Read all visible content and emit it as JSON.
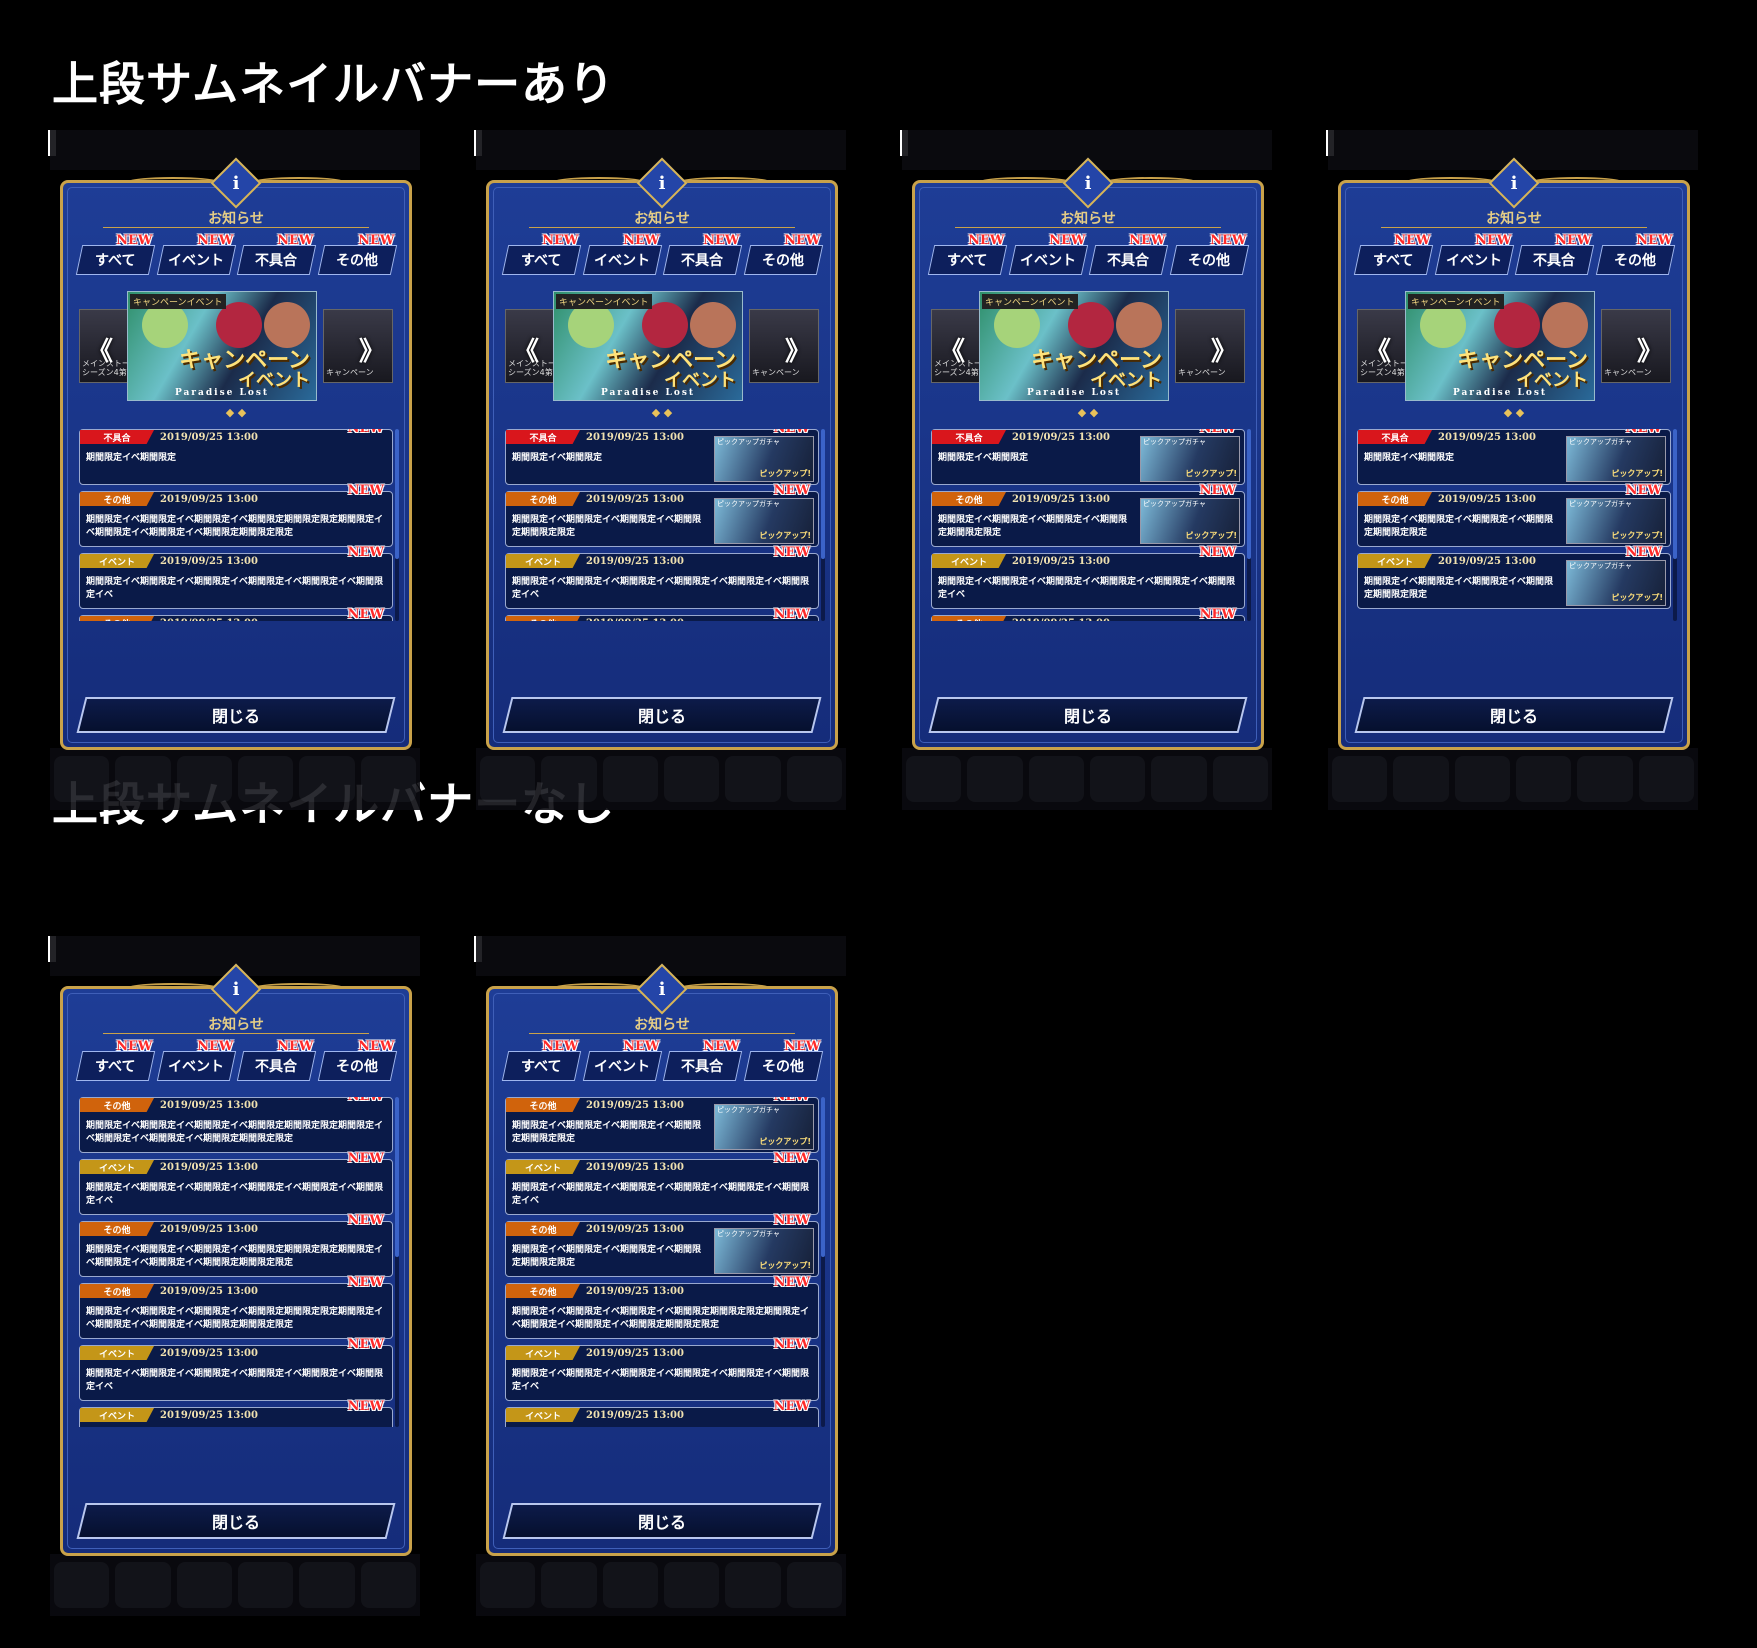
{
  "sections": [
    {
      "title": "上段サムネイルバナーあり"
    },
    {
      "title": "上段サムネイルバナーなし"
    }
  ],
  "panel": {
    "info_icon": "i",
    "title": "お知らせ",
    "tabs": [
      "すべて",
      "イベント",
      "不具合",
      "その他"
    ],
    "new_label": "NEW",
    "close_label": "閉じる"
  },
  "banner": {
    "tag": "キャンペーンイベント",
    "title_line1": "キャンペーン",
    "title_line2": "イベント",
    "footer": "Paradise Lost",
    "left_text": "メインストーリーシーズン4第1章",
    "right_text": "キャンペーン",
    "dots": "◆ ◆",
    "prev": "《",
    "next": "》"
  },
  "thumb": {
    "label": "ピックアップガチャ",
    "caption": "ピックアップ!"
  },
  "categories": {
    "bug": "不具合",
    "other": "その他",
    "event": "イベント"
  },
  "date": "2019/09/25 13:00",
  "bodies": {
    "short": "期間限定イベ期間限定",
    "other_long": "期間限定イベ期間限定イベ期間限定イベ期間限定期間限定限定期間限定イベ期間限定イベ期間限定イベ期間限定期間限定限定",
    "event_long": "期間限定イベ期間限定イベ期間限定イベ期間限定イベ期間限定イベ期間限定イベ",
    "other_thumb": "期間限定イベ期間限定イベ期間限定イベ期間限定期間限定限定"
  },
  "colors": {
    "panel": "#1e3d96",
    "gold": "#c9a24a",
    "new": "#ff2a2a",
    "bug": "#d9161c",
    "other": "#d0630c",
    "event": "#c49618"
  },
  "icons": [
    "info-icon",
    "prev-arrow-icon",
    "next-arrow-icon",
    "pager-dot-icon"
  ]
}
